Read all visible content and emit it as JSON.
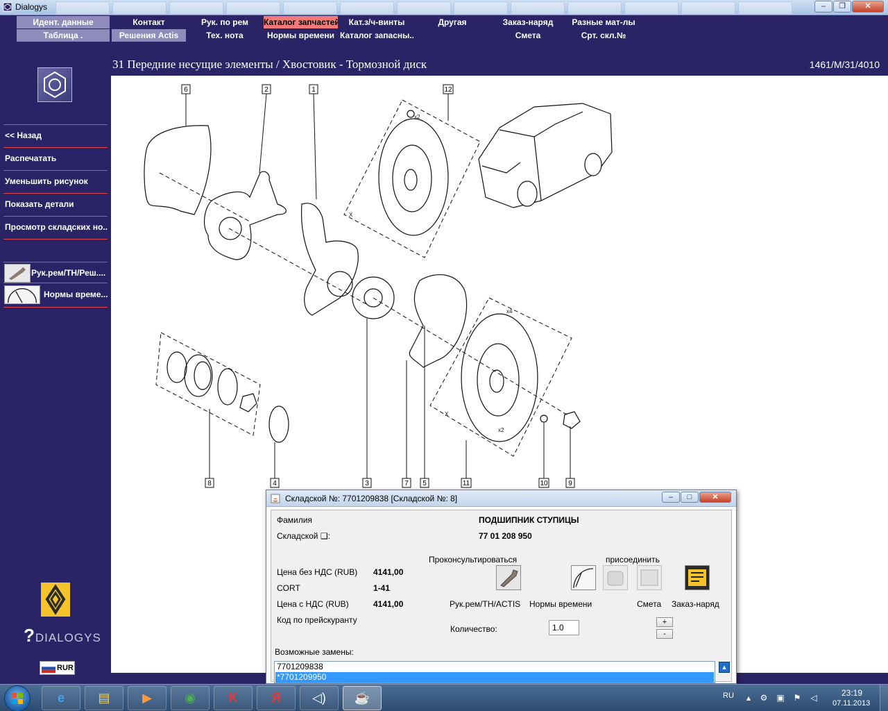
{
  "window": {
    "title": "Dialogys"
  },
  "menu": {
    "row1": [
      "Идент. данные",
      "Контакт",
      "Рук. по рем",
      "Каталог запчастей",
      "Кат.з/ч-винты",
      "Другая",
      "Заказ-наряд",
      "Разные мат-лы"
    ],
    "row2": [
      "Таблица .",
      "Решения Actis",
      "Тех. нота",
      "Нормы времени",
      "Каталог запасны...",
      "",
      "Смета",
      "Срт. скл.№"
    ],
    "active": "Каталог запчастей"
  },
  "header": {
    "breadcrumb": "31 Передние несущие элементы / Хвостовик - Тормозной диск",
    "ref": "1461/M/31/4010"
  },
  "sidebar": {
    "items": [
      "<< Назад",
      "Распечатать",
      "Уменьшить рисунок",
      "Показать детали",
      "Просмотр складских но..."
    ],
    "links": [
      "Рук.рем/ТН/Реш....",
      "Нормы време..."
    ],
    "brand": "DIALOGYS",
    "currency": "RUR"
  },
  "drawing": {
    "callouts": [
      "6",
      "2",
      "1",
      "12",
      "8",
      "4",
      "3",
      "7",
      "5",
      "11",
      "10",
      "9"
    ],
    "qty_marks": [
      "x2",
      "x4",
      "x2"
    ],
    "axis_marks": [
      "X",
      "X"
    ]
  },
  "dialog": {
    "title": "Складской №: 7701209838 [Складской №: 8]",
    "family_label": "Фамилия",
    "family_value": "ПОДШИПНИК СТУПИЦЫ",
    "stock_label": "Складской ❏:",
    "stock_value": "77 01 208 950",
    "consult_label": "Проконсультироваться",
    "attach_label": "присоединить",
    "price_net_label": "Цена без НДС (RUB)",
    "price_net_value": "4141,00",
    "cort_label": "CORT",
    "cort_value": "1-41",
    "price_vat_label": "Цена с НДС (RUB)",
    "price_vat_value": "4141,00",
    "pricelist_label": "Код по прейскуранту",
    "icon_labels": [
      "Рук.рем/ТН/ACTIS",
      "Нормы времени",
      "Смета",
      "Заказ-наряд"
    ],
    "qty_label": "Количество:",
    "qty_value": "1.0",
    "plus": "+",
    "minus": "-",
    "subs_label": "Возможные замены:",
    "substitutes": [
      "7701209838",
      "*7701209950"
    ]
  },
  "taskbar": {
    "lang": "RU",
    "time": "23:19",
    "date": "07.11.2013"
  },
  "colors": {
    "bg": "#2a2466",
    "menu_light": "#8f8cbc",
    "menu_active": "#f07a7a",
    "separator": "#e24a4a",
    "selection": "#3399ff"
  }
}
